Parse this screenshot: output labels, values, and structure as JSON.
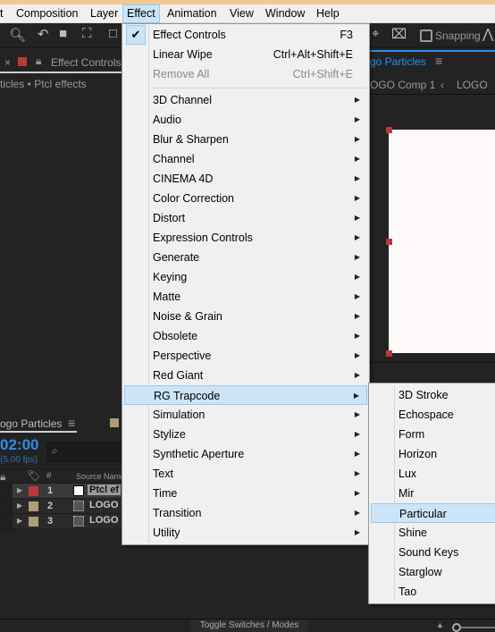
{
  "menubar": {
    "items": [
      "t",
      "Composition",
      "Layer",
      "Effect",
      "Animation",
      "View",
      "Window",
      "Help"
    ],
    "active": "Effect"
  },
  "toolbar": {
    "snapping_label": "Snapping"
  },
  "panels": {
    "effect_controls_tab": "Effect Controls",
    "effect_controls_path": "ticles • Ptcl effects",
    "comp_tab": "go Particles",
    "comp_breadcrumb": [
      "OGO Comp 1",
      "LOGO"
    ],
    "timeline_tab": "ogo Particles",
    "timecode": "02:00",
    "fps": "(5.00 fps)",
    "search_placeholder": "",
    "columns": {
      "number": "#",
      "source_name": "Source Name"
    },
    "layers": [
      {
        "num": "1",
        "name": "Ptcl ef",
        "label_color": "#b83a3a",
        "selected": true
      },
      {
        "num": "2",
        "name": "LOGO",
        "label_color": "#b09c78",
        "selected": false
      },
      {
        "num": "3",
        "name": "LOGO",
        "label_color": "#b09c78",
        "selected": false
      }
    ],
    "toggle_label": "Toggle Switches / Modes"
  },
  "effect_menu": {
    "top": [
      {
        "label": "Effect Controls",
        "shortcut": "F3",
        "checked": true
      },
      {
        "label": "Linear Wipe",
        "shortcut": "Ctrl+Alt+Shift+E"
      },
      {
        "label": "Remove All",
        "shortcut": "Ctrl+Shift+E",
        "disabled": true
      }
    ],
    "categories": [
      "3D Channel",
      "Audio",
      "Blur & Sharpen",
      "Channel",
      "CINEMA 4D",
      "Color Correction",
      "Distort",
      "Expression Controls",
      "Generate",
      "Keying",
      "Matte",
      "Noise & Grain",
      "Obsolete",
      "Perspective",
      "Red Giant",
      "RG Trapcode",
      "Simulation",
      "Stylize",
      "Synthetic Aperture",
      "Text",
      "Time",
      "Transition",
      "Utility"
    ],
    "highlighted": "RG Trapcode"
  },
  "trapcode_submenu": {
    "items": [
      "3D Stroke",
      "Echospace",
      "Form",
      "Horizon",
      "Lux",
      "Mir",
      "Particular",
      "Shine",
      "Sound Keys",
      "Starglow",
      "Tao"
    ],
    "highlighted": "Particular"
  },
  "colors": {
    "accent": "#2d8ceb",
    "menu_highlight": "#cce4f7",
    "timecode": "#2d8ceb"
  }
}
